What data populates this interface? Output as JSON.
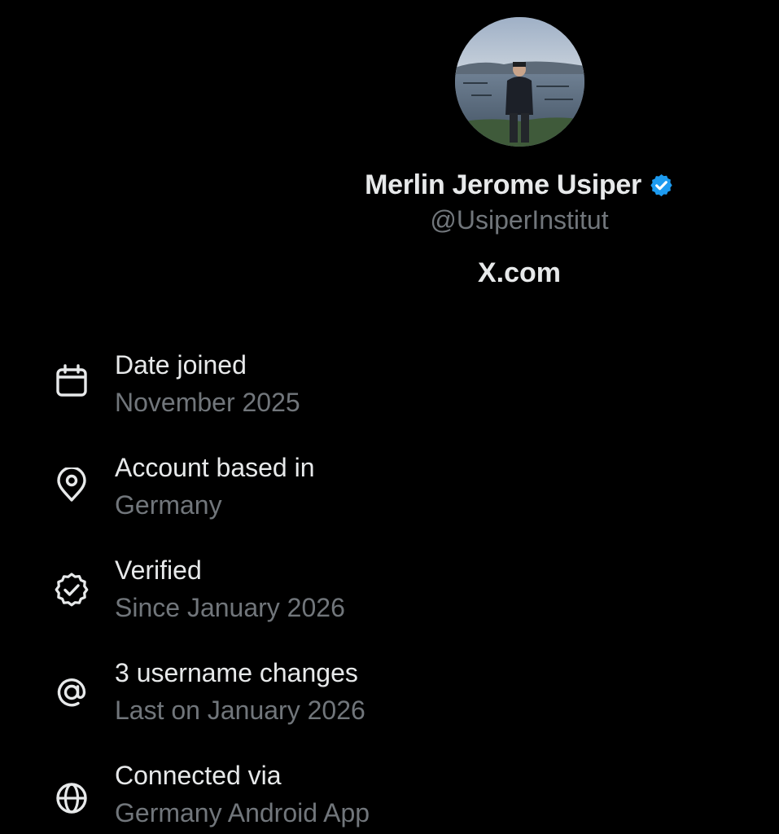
{
  "profile": {
    "display_name": "Merlin Jerome Usiper",
    "handle": "@UsiperInstitut",
    "site_label": "X.com",
    "verified_color": "#1d9bf0",
    "avatar_description_icon": "profile-photo"
  },
  "about": {
    "items": [
      {
        "icon": "calendar-icon",
        "title": "Date joined",
        "subtitle": "November 2025"
      },
      {
        "icon": "location-pin-icon",
        "title": "Account based in",
        "subtitle": "Germany"
      },
      {
        "icon": "verified-badge-outline-icon",
        "title": "Verified",
        "subtitle": "Since January 2026"
      },
      {
        "icon": "at-sign-icon",
        "title": "3 username changes",
        "subtitle": "Last on January 2026"
      },
      {
        "icon": "globe-icon",
        "title": "Connected via",
        "subtitle": "Germany Android App"
      }
    ]
  },
  "colors": {
    "background": "#000000",
    "primary_text": "#e7e9ea",
    "secondary_text": "#71767b",
    "accent": "#1d9bf0"
  }
}
